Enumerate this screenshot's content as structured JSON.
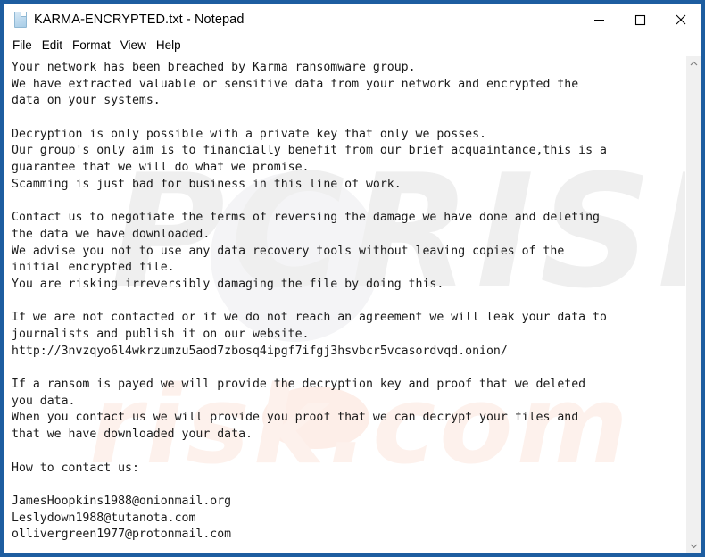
{
  "window": {
    "title": "KARMA-ENCRYPTED.txt - Notepad",
    "icon": "notepad-document-icon",
    "border_color": "#1d5da0",
    "controls": {
      "minimize_label": "–",
      "maximize_label": "□",
      "close_label": "✕"
    }
  },
  "menu": {
    "items": [
      {
        "label": "File"
      },
      {
        "label": "Edit"
      },
      {
        "label": "Format"
      },
      {
        "label": "View"
      },
      {
        "label": "Help"
      }
    ]
  },
  "document": {
    "filename": "KARMA-ENCRYPTED.txt",
    "lines": [
      "Your network has been breached by Karma ransomware group.",
      "We have extracted valuable or sensitive data from your network and encrypted the",
      "data on your systems.",
      "",
      "Decryption is only possible with a private key that only we posses.",
      "Our group's only aim is to financially benefit from our brief acquaintance,this is a",
      "guarantee that we will do what we promise.",
      "Scamming is just bad for business in this line of work.",
      "",
      "Contact us to negotiate the terms of reversing the damage we have done and deleting",
      "the data we have downloaded.",
      "We advise you not to use any data recovery tools without leaving copies of the",
      "initial encrypted file.",
      "You are risking irreversibly damaging the file by doing this.",
      "",
      "If we are not contacted or if we do not reach an agreement we will leak your data to",
      "journalists and publish it on our website.",
      "http://3nvzqyo6l4wkrzumzu5aod7zbosq4ipgf7ifgj3hsvbcr5vcasordvqd.onion/",
      "",
      "If a ransom is payed we will provide the decryption key and proof that we deleted",
      "you data.",
      "When you contact us we will provide you proof that we can decrypt your files and",
      "that we have downloaded your data.",
      "",
      "How to contact us:",
      "",
      "JamesHoopkins1988@onionmail.org",
      "Leslydown1988@tutanota.com",
      "ollivergreen1977@protonmail.com"
    ],
    "onion_url": "http://3nvzqyo6l4wkrzumzu5aod7zbosq4ipgf7ifgj3hsvbcr5vcasordvqd.onion/",
    "emails": [
      "JamesHoopkins1988@onionmail.org",
      "Leslydown1988@tutanota.com",
      "ollivergreen1977@protonmail.com"
    ]
  },
  "watermark": {
    "top_text": "PCRISK",
    "bottom_text": "risk.com"
  },
  "scrollbar": {
    "up_arrow": "chevron-up-icon",
    "down_arrow": "chevron-down-icon"
  }
}
